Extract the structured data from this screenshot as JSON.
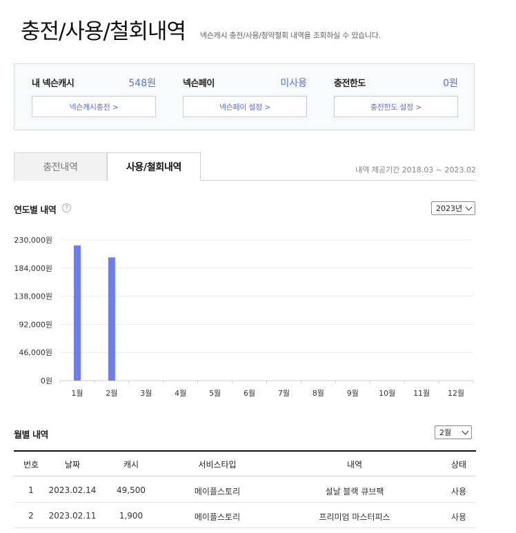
{
  "page": {
    "title": "충전/사용/철회내역",
    "description": "넥슨캐시 충전/사용/청약철회 내역을 조회하실 수 있습니다."
  },
  "summary": [
    {
      "label": "내 넥슨캐시",
      "value": "548원",
      "button": "넥슨캐시충전 >"
    },
    {
      "label": "넥슨페이",
      "value": "미사용",
      "button": "넥슨페이 설정 >"
    },
    {
      "label": "충전한도",
      "value": "0원",
      "button": "충전한도 설정 >"
    }
  ],
  "tabs": [
    {
      "label": "충전내역",
      "active": false
    },
    {
      "label": "사용/철회내역",
      "active": true
    }
  ],
  "period": "내역 제공기간 2018.03 ~ 2023.02",
  "yearly": {
    "title": "연도별 내역",
    "help_icon": "question-circle-icon",
    "year_select": "2023년"
  },
  "chart_data": {
    "type": "bar",
    "categories": [
      "1월",
      "2월",
      "3월",
      "4월",
      "5월",
      "6월",
      "7월",
      "8월",
      "9월",
      "10월",
      "11월",
      "12월"
    ],
    "values": [
      221000,
      201500,
      0,
      0,
      0,
      0,
      0,
      0,
      0,
      0,
      0,
      0
    ],
    "y_ticks": [
      "230,000원",
      "184,000원",
      "138,000원",
      "92,000원",
      "46,000원",
      "0원"
    ],
    "ylim": [
      0,
      230000
    ],
    "grid": true,
    "bar_color": "#6c7df5"
  },
  "monthly": {
    "title": "월별 내역",
    "month_select": "2월",
    "columns": [
      "번호",
      "날짜",
      "캐시",
      "서비스타입",
      "내역",
      "상태"
    ],
    "rows": [
      [
        "1",
        "2023.02.14",
        "49,500",
        "메이플스토리",
        "설날 블랙 큐브팩",
        "사용"
      ],
      [
        "2",
        "2023.02.11",
        "1,900",
        "메이플스토리",
        "프리미엄 마스터피스",
        "사용"
      ]
    ]
  },
  "colors": {
    "accent": "#5a6fe0",
    "bar": "#6c7df5"
  }
}
